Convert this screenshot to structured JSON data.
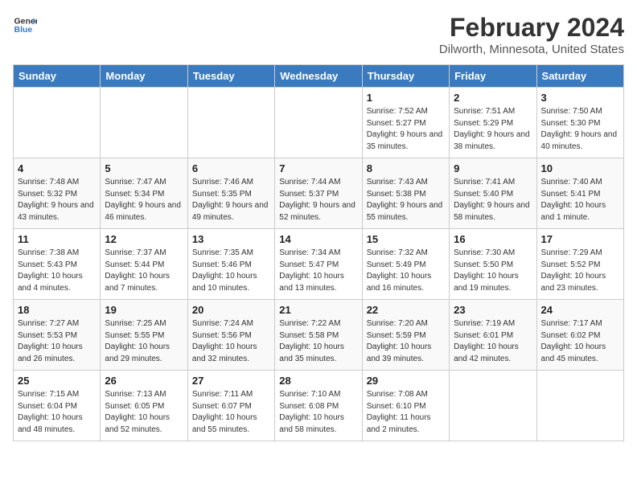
{
  "header": {
    "logo_general": "General",
    "logo_blue": "Blue",
    "title": "February 2024",
    "subtitle": "Dilworth, Minnesota, United States"
  },
  "days_of_week": [
    "Sunday",
    "Monday",
    "Tuesday",
    "Wednesday",
    "Thursday",
    "Friday",
    "Saturday"
  ],
  "weeks": [
    [
      {
        "day": "",
        "sunrise": "",
        "sunset": "",
        "daylight": ""
      },
      {
        "day": "",
        "sunrise": "",
        "sunset": "",
        "daylight": ""
      },
      {
        "day": "",
        "sunrise": "",
        "sunset": "",
        "daylight": ""
      },
      {
        "day": "",
        "sunrise": "",
        "sunset": "",
        "daylight": ""
      },
      {
        "day": "1",
        "sunrise": "Sunrise: 7:52 AM",
        "sunset": "Sunset: 5:27 PM",
        "daylight": "Daylight: 9 hours and 35 minutes."
      },
      {
        "day": "2",
        "sunrise": "Sunrise: 7:51 AM",
        "sunset": "Sunset: 5:29 PM",
        "daylight": "Daylight: 9 hours and 38 minutes."
      },
      {
        "day": "3",
        "sunrise": "Sunrise: 7:50 AM",
        "sunset": "Sunset: 5:30 PM",
        "daylight": "Daylight: 9 hours and 40 minutes."
      }
    ],
    [
      {
        "day": "4",
        "sunrise": "Sunrise: 7:48 AM",
        "sunset": "Sunset: 5:32 PM",
        "daylight": "Daylight: 9 hours and 43 minutes."
      },
      {
        "day": "5",
        "sunrise": "Sunrise: 7:47 AM",
        "sunset": "Sunset: 5:34 PM",
        "daylight": "Daylight: 9 hours and 46 minutes."
      },
      {
        "day": "6",
        "sunrise": "Sunrise: 7:46 AM",
        "sunset": "Sunset: 5:35 PM",
        "daylight": "Daylight: 9 hours and 49 minutes."
      },
      {
        "day": "7",
        "sunrise": "Sunrise: 7:44 AM",
        "sunset": "Sunset: 5:37 PM",
        "daylight": "Daylight: 9 hours and 52 minutes."
      },
      {
        "day": "8",
        "sunrise": "Sunrise: 7:43 AM",
        "sunset": "Sunset: 5:38 PM",
        "daylight": "Daylight: 9 hours and 55 minutes."
      },
      {
        "day": "9",
        "sunrise": "Sunrise: 7:41 AM",
        "sunset": "Sunset: 5:40 PM",
        "daylight": "Daylight: 9 hours and 58 minutes."
      },
      {
        "day": "10",
        "sunrise": "Sunrise: 7:40 AM",
        "sunset": "Sunset: 5:41 PM",
        "daylight": "Daylight: 10 hours and 1 minute."
      }
    ],
    [
      {
        "day": "11",
        "sunrise": "Sunrise: 7:38 AM",
        "sunset": "Sunset: 5:43 PM",
        "daylight": "Daylight: 10 hours and 4 minutes."
      },
      {
        "day": "12",
        "sunrise": "Sunrise: 7:37 AM",
        "sunset": "Sunset: 5:44 PM",
        "daylight": "Daylight: 10 hours and 7 minutes."
      },
      {
        "day": "13",
        "sunrise": "Sunrise: 7:35 AM",
        "sunset": "Sunset: 5:46 PM",
        "daylight": "Daylight: 10 hours and 10 minutes."
      },
      {
        "day": "14",
        "sunrise": "Sunrise: 7:34 AM",
        "sunset": "Sunset: 5:47 PM",
        "daylight": "Daylight: 10 hours and 13 minutes."
      },
      {
        "day": "15",
        "sunrise": "Sunrise: 7:32 AM",
        "sunset": "Sunset: 5:49 PM",
        "daylight": "Daylight: 10 hours and 16 minutes."
      },
      {
        "day": "16",
        "sunrise": "Sunrise: 7:30 AM",
        "sunset": "Sunset: 5:50 PM",
        "daylight": "Daylight: 10 hours and 19 minutes."
      },
      {
        "day": "17",
        "sunrise": "Sunrise: 7:29 AM",
        "sunset": "Sunset: 5:52 PM",
        "daylight": "Daylight: 10 hours and 23 minutes."
      }
    ],
    [
      {
        "day": "18",
        "sunrise": "Sunrise: 7:27 AM",
        "sunset": "Sunset: 5:53 PM",
        "daylight": "Daylight: 10 hours and 26 minutes."
      },
      {
        "day": "19",
        "sunrise": "Sunrise: 7:25 AM",
        "sunset": "Sunset: 5:55 PM",
        "daylight": "Daylight: 10 hours and 29 minutes."
      },
      {
        "day": "20",
        "sunrise": "Sunrise: 7:24 AM",
        "sunset": "Sunset: 5:56 PM",
        "daylight": "Daylight: 10 hours and 32 minutes."
      },
      {
        "day": "21",
        "sunrise": "Sunrise: 7:22 AM",
        "sunset": "Sunset: 5:58 PM",
        "daylight": "Daylight: 10 hours and 35 minutes."
      },
      {
        "day": "22",
        "sunrise": "Sunrise: 7:20 AM",
        "sunset": "Sunset: 5:59 PM",
        "daylight": "Daylight: 10 hours and 39 minutes."
      },
      {
        "day": "23",
        "sunrise": "Sunrise: 7:19 AM",
        "sunset": "Sunset: 6:01 PM",
        "daylight": "Daylight: 10 hours and 42 minutes."
      },
      {
        "day": "24",
        "sunrise": "Sunrise: 7:17 AM",
        "sunset": "Sunset: 6:02 PM",
        "daylight": "Daylight: 10 hours and 45 minutes."
      }
    ],
    [
      {
        "day": "25",
        "sunrise": "Sunrise: 7:15 AM",
        "sunset": "Sunset: 6:04 PM",
        "daylight": "Daylight: 10 hours and 48 minutes."
      },
      {
        "day": "26",
        "sunrise": "Sunrise: 7:13 AM",
        "sunset": "Sunset: 6:05 PM",
        "daylight": "Daylight: 10 hours and 52 minutes."
      },
      {
        "day": "27",
        "sunrise": "Sunrise: 7:11 AM",
        "sunset": "Sunset: 6:07 PM",
        "daylight": "Daylight: 10 hours and 55 minutes."
      },
      {
        "day": "28",
        "sunrise": "Sunrise: 7:10 AM",
        "sunset": "Sunset: 6:08 PM",
        "daylight": "Daylight: 10 hours and 58 minutes."
      },
      {
        "day": "29",
        "sunrise": "Sunrise: 7:08 AM",
        "sunset": "Sunset: 6:10 PM",
        "daylight": "Daylight: 11 hours and 2 minutes."
      },
      {
        "day": "",
        "sunrise": "",
        "sunset": "",
        "daylight": ""
      },
      {
        "day": "",
        "sunrise": "",
        "sunset": "",
        "daylight": ""
      }
    ]
  ]
}
